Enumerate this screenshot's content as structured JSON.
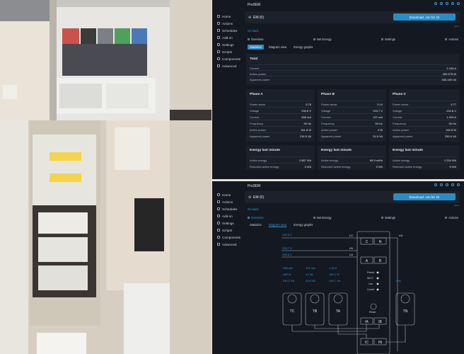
{
  "app": {
    "brand": "Pro3EM",
    "device_name": "EM (0)",
    "download_label": "Download .csv for 1h",
    "version": "ver 0"
  },
  "sidebar": {
    "items": [
      {
        "label": "Home",
        "icon": "home-icon"
      },
      {
        "label": "Actions",
        "icon": "actions-icon"
      },
      {
        "label": "Schedules",
        "icon": "schedules-icon"
      },
      {
        "label": "Add-on",
        "icon": "addon-icon"
      },
      {
        "label": "Settings",
        "icon": "settings-icon"
      },
      {
        "label": "Scripts",
        "icon": "scripts-icon"
      },
      {
        "label": "Components",
        "icon": "components-icon"
      },
      {
        "label": "Advanced",
        "icon": "advanced-icon"
      }
    ]
  },
  "nav": {
    "go_back": "Go back",
    "tabs": [
      "Overview",
      "Net Energy",
      "Settings",
      "Actions"
    ],
    "subtabs": [
      "Statistics",
      "Diagram view",
      "Energy graphs"
    ]
  },
  "total": {
    "title": "Total",
    "rows": [
      {
        "label": "Current",
        "value": "2.156 A"
      },
      {
        "label": "Active power",
        "value": "350.578 W"
      },
      {
        "label": "Apparent power",
        "value": "466.185 VA"
      }
    ]
  },
  "phases": [
    {
      "title": "Phase A",
      "rows": [
        {
          "label": "Power factor",
          "value": "0.76"
        },
        {
          "label": "Voltage",
          "value": "230.6 V"
        },
        {
          "label": "Current",
          "value": "938 mA"
        },
        {
          "label": "Frequency",
          "value": "50 Hz"
        },
        {
          "label": "Active power",
          "value": "161.8 W"
        },
        {
          "label": "Apparent power",
          "value": "216.5 VA"
        }
      ]
    },
    {
      "title": "Phase B",
      "rows": [
        {
          "label": "Power factor",
          "value": "0.14"
        },
        {
          "label": "Voltage",
          "value": "233.7 V"
        },
        {
          "label": "Current",
          "value": "137 mA"
        },
        {
          "label": "Frequency",
          "value": "50 Hz"
        },
        {
          "label": "Active power",
          "value": "4 W"
        },
        {
          "label": "Apparent power",
          "value": "31.8 VA"
        }
      ]
    },
    {
      "title": "Phase C",
      "rows": [
        {
          "label": "Power factor",
          "value": "0.77"
        },
        {
          "label": "Voltage",
          "value": "232.8 V"
        },
        {
          "label": "Current",
          "value": "1.029 A"
        },
        {
          "label": "Frequency",
          "value": "50 Hz"
        },
        {
          "label": "Active power",
          "value": "184.8 W"
        },
        {
          "label": "Apparent power",
          "value": "239.6 VA"
        }
      ]
    }
  ],
  "energy": [
    {
      "title": "Energy last minute",
      "rows": [
        {
          "label": "Active energy",
          "value": "2.687 Wh"
        },
        {
          "label": "Returned active energy",
          "value": "0 Wh"
        }
      ]
    },
    {
      "title": "Energy last minute",
      "rows": [
        {
          "label": "Active energy",
          "value": "69.9 mWh"
        },
        {
          "label": "Returned active energy",
          "value": "0 Wh"
        }
      ]
    },
    {
      "title": "Energy last minute",
      "rows": [
        {
          "label": "Active energy",
          "value": "1.234 Wh"
        },
        {
          "label": "Returned active energy",
          "value": "0 Wh"
        }
      ]
    }
  ],
  "diagram": {
    "volt_c": "232.8 V",
    "volt_b": "233.7 V",
    "volt_a": "230.6 V",
    "lines": [
      "LC",
      "LB",
      "LA",
      "LN"
    ],
    "terminals": [
      "C",
      "N",
      "A",
      "B",
      "IA",
      "IB",
      "IC",
      "IN"
    ],
    "leds": [
      "Power",
      "Wi-Fi",
      "Lan",
      "Count"
    ],
    "reset": "Reset",
    "clamps": [
      "TC",
      "TB",
      "TA",
      "TN"
    ],
    "clamp_na": "N/A",
    "readings": [
      [
        "938 mA",
        "137 mA",
        "1.03 A"
      ],
      [
        "185 W",
        "4.2 W",
        "162.1 W"
      ],
      [
        "240.2 VA",
        "31.8 VA",
        "216.7 VA"
      ]
    ]
  },
  "colors": {
    "bg": "#141820",
    "card": "#1b212b",
    "accent": "#2b8cc4",
    "link": "#2f9be0"
  }
}
